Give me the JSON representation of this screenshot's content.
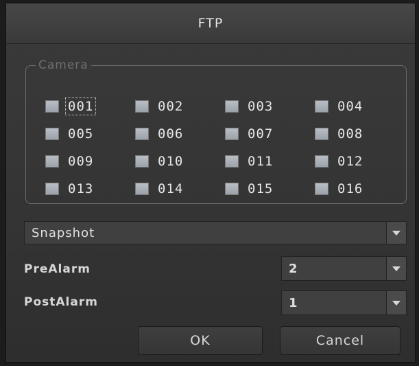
{
  "dialog": {
    "title": "FTP",
    "camera_group": {
      "legend": "Camera",
      "cameras": [
        "001",
        "002",
        "003",
        "004",
        "005",
        "006",
        "007",
        "008",
        "009",
        "010",
        "011",
        "012",
        "013",
        "014",
        "015",
        "016"
      ],
      "focused_camera": "001"
    },
    "mode_select": {
      "value": "Snapshot"
    },
    "pre_alarm": {
      "label": "PreAlarm",
      "value": "2"
    },
    "post_alarm": {
      "label": "PostAlarm",
      "value": "1"
    },
    "buttons": {
      "ok_label": "OK",
      "cancel_label": "Cancel"
    }
  }
}
